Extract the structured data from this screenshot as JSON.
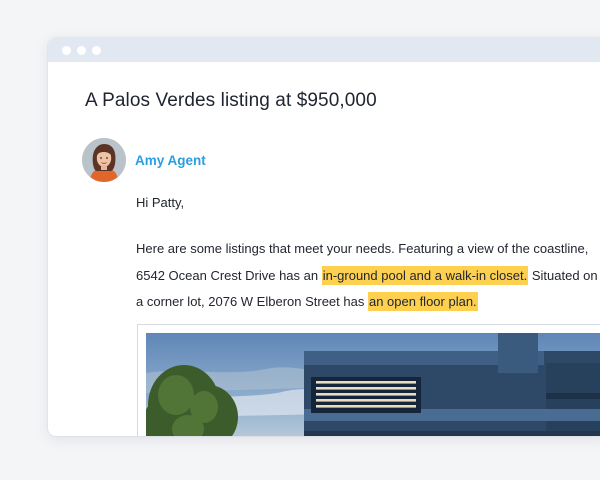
{
  "window": {
    "controls": [
      "dot",
      "dot",
      "dot"
    ]
  },
  "email": {
    "subject": "A Palos Verdes listing at $950,000",
    "sender": "Amy Agent",
    "greeting": "Hi Patty,",
    "body": {
      "part1": "Here are some listings that meet your needs. Featuring a view of the coastline, 6542 Ocean Crest Drive has an ",
      "highlight1": "in-ground pool and a walk-in closet.",
      "part2": " Situated on a corner lot, 2076 W Elberon Street has ",
      "highlight2": "an open floor plan."
    }
  },
  "colors": {
    "accent": "#2a9fe0",
    "highlight": "#fdd14f",
    "titlebar": "#e2e8f2"
  }
}
